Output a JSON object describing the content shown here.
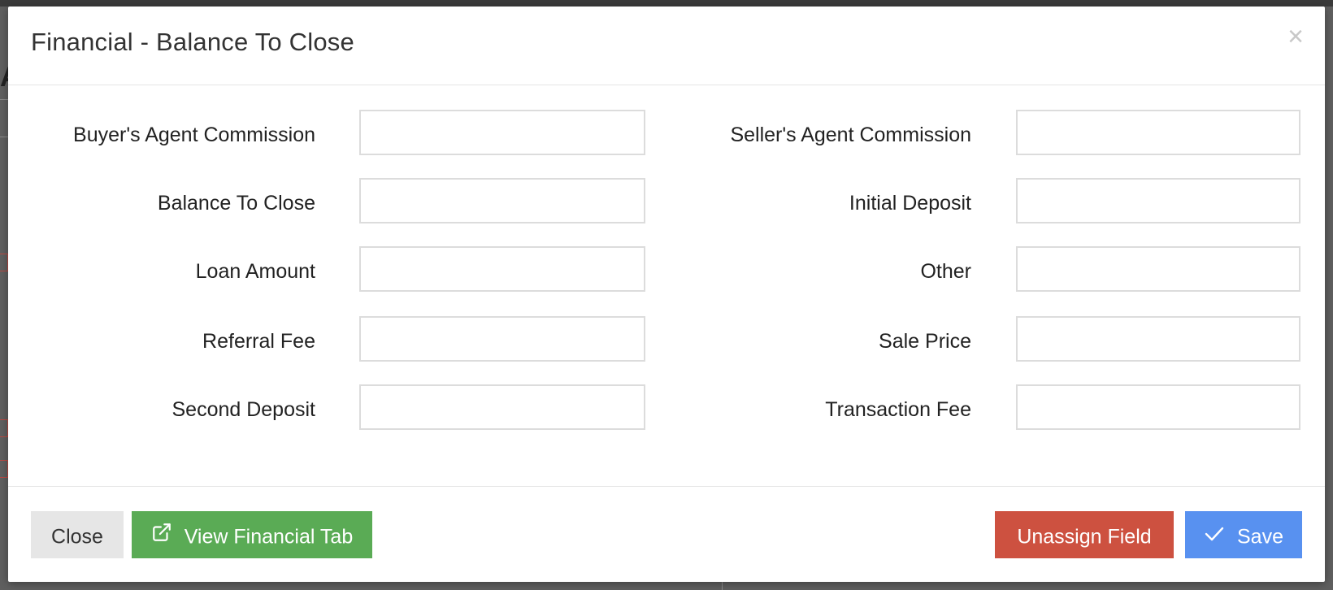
{
  "modal": {
    "title": "Financial - Balance To Close",
    "close_glyph": "×"
  },
  "fields": {
    "left": [
      {
        "label": "Buyer's Agent Commission",
        "value": ""
      },
      {
        "label": "Balance To Close",
        "value": ""
      },
      {
        "label": "Loan Amount",
        "value": ""
      },
      {
        "label": "Referral Fee",
        "value": ""
      },
      {
        "label": "Second Deposit",
        "value": ""
      }
    ],
    "right": [
      {
        "label": "Seller's Agent Commission",
        "value": ""
      },
      {
        "label": "Initial Deposit",
        "value": ""
      },
      {
        "label": "Other",
        "value": ""
      },
      {
        "label": "Sale Price",
        "value": ""
      },
      {
        "label": "Transaction Fee",
        "value": ""
      }
    ]
  },
  "footer": {
    "close_label": "Close",
    "view_label": "View Financial Tab",
    "view_icon": "external-link-icon",
    "unassign_label": "Unassign Field",
    "save_label": "Save",
    "save_icon": "check-icon"
  },
  "colors": {
    "view_button": "#5aab55",
    "unassign_button": "#cd5140",
    "save_button": "#5891f0",
    "close_button": "#e6e6e6"
  },
  "background": {
    "fragment_a": "A"
  }
}
